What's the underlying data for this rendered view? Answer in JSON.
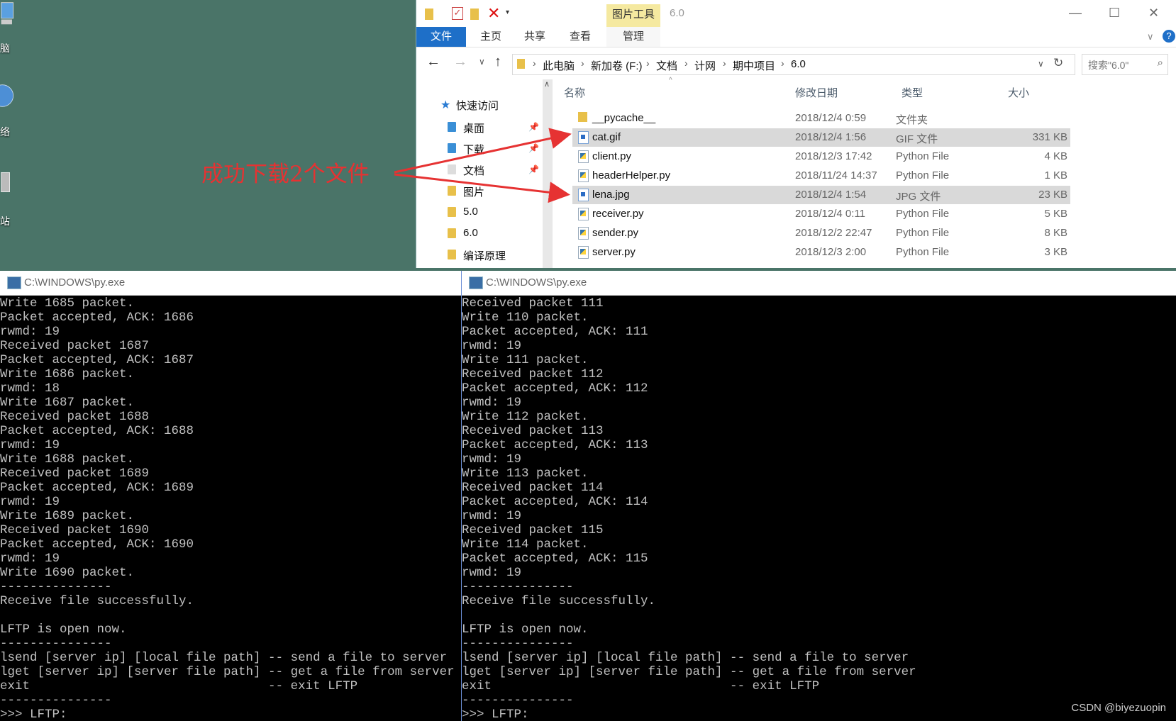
{
  "desktop": {
    "icons": [
      {
        "label": "脑",
        "icon": "computer-icon"
      },
      {
        "label": "络",
        "icon": "network-icon"
      },
      {
        "label": "站",
        "icon": "recycle-bin-icon"
      }
    ]
  },
  "annotation": {
    "text": "成功下载2个文件",
    "color": "#e63232"
  },
  "explorer": {
    "title": "6.0",
    "context_tab": "图片工具",
    "ribbon_tabs": [
      "文件",
      "主页",
      "共享",
      "查看",
      "管理"
    ],
    "breadcrumb": [
      "此电脑",
      "新加卷 (F:)",
      "文档",
      "计网",
      "期中项目",
      "6.0"
    ],
    "search_placeholder": "搜索\"6.0\"",
    "nav": {
      "quick_access": "快速访问",
      "items": [
        "桌面",
        "下载",
        "文档",
        "图片",
        "5.0",
        "6.0",
        "编译原理"
      ]
    },
    "columns": [
      "名称",
      "修改日期",
      "类型",
      "大小"
    ],
    "files": [
      {
        "name": "__pycache__",
        "date": "2018/12/4 0:59",
        "type": "文件夹",
        "size": "",
        "selected": false,
        "icon": "folder-icon"
      },
      {
        "name": "cat.gif",
        "date": "2018/12/4 1:56",
        "type": "GIF 文件",
        "size": "331 KB",
        "selected": true,
        "icon": "image-file-icon"
      },
      {
        "name": "client.py",
        "date": "2018/12/3 17:42",
        "type": "Python File",
        "size": "4 KB",
        "selected": false,
        "icon": "python-file-icon"
      },
      {
        "name": "headerHelper.py",
        "date": "2018/11/24 14:37",
        "type": "Python File",
        "size": "1 KB",
        "selected": false,
        "icon": "python-file-icon"
      },
      {
        "name": "lena.jpg",
        "date": "2018/12/4 1:54",
        "type": "JPG 文件",
        "size": "23 KB",
        "selected": true,
        "icon": "image-file-icon"
      },
      {
        "name": "receiver.py",
        "date": "2018/12/4 0:11",
        "type": "Python File",
        "size": "5 KB",
        "selected": false,
        "icon": "python-file-icon"
      },
      {
        "name": "sender.py",
        "date": "2018/12/2 22:47",
        "type": "Python File",
        "size": "8 KB",
        "selected": false,
        "icon": "python-file-icon"
      },
      {
        "name": "server.py",
        "date": "2018/12/3 2:00",
        "type": "Python File",
        "size": "3 KB",
        "selected": false,
        "icon": "python-file-icon"
      }
    ]
  },
  "console_left": {
    "title": "C:\\WINDOWS\\py.exe",
    "lines": [
      "Write 1685 packet.",
      "Packet accepted, ACK: 1686",
      "rwmd: 19",
      "Received packet 1687",
      "Packet accepted, ACK: 1687",
      "Write 1686 packet.",
      "rwmd: 18",
      "Write 1687 packet.",
      "Received packet 1688",
      "Packet accepted, ACK: 1688",
      "rwmd: 19",
      "Write 1688 packet.",
      "Received packet 1689",
      "Packet accepted, ACK: 1689",
      "rwmd: 19",
      "Write 1689 packet.",
      "Received packet 1690",
      "Packet accepted, ACK: 1690",
      "rwmd: 19",
      "Write 1690 packet.",
      "---------------",
      "Receive file successfully.",
      "",
      "LFTP is open now.",
      "---------------",
      "lsend [server ip] [local file path] -- send a file to server",
      "lget [server ip] [server file path] -- get a file from server",
      "exit                                -- exit LFTP",
      "---------------",
      ">>> LFTP:"
    ]
  },
  "console_right": {
    "title": "C:\\WINDOWS\\py.exe",
    "lines": [
      "Received packet 111",
      "Write 110 packet.",
      "Packet accepted, ACK: 111",
      "rwmd: 19",
      "Write 111 packet.",
      "Received packet 112",
      "Packet accepted, ACK: 112",
      "rwmd: 19",
      "Write 112 packet.",
      "Received packet 113",
      "Packet accepted, ACK: 113",
      "rwmd: 19",
      "Write 113 packet.",
      "Received packet 114",
      "Packet accepted, ACK: 114",
      "rwmd: 19",
      "Received packet 115",
      "Write 114 packet.",
      "Packet accepted, ACK: 115",
      "rwmd: 19",
      "---------------",
      "Receive file successfully.",
      "",
      "LFTP is open now.",
      "---------------",
      "lsend [server ip] [local file path] -- send a file to server",
      "lget [server ip] [server file path] -- get a file from server",
      "exit                                -- exit LFTP",
      "---------------",
      ">>> LFTP:"
    ]
  },
  "watermark": "CSDN @biyezuopin"
}
